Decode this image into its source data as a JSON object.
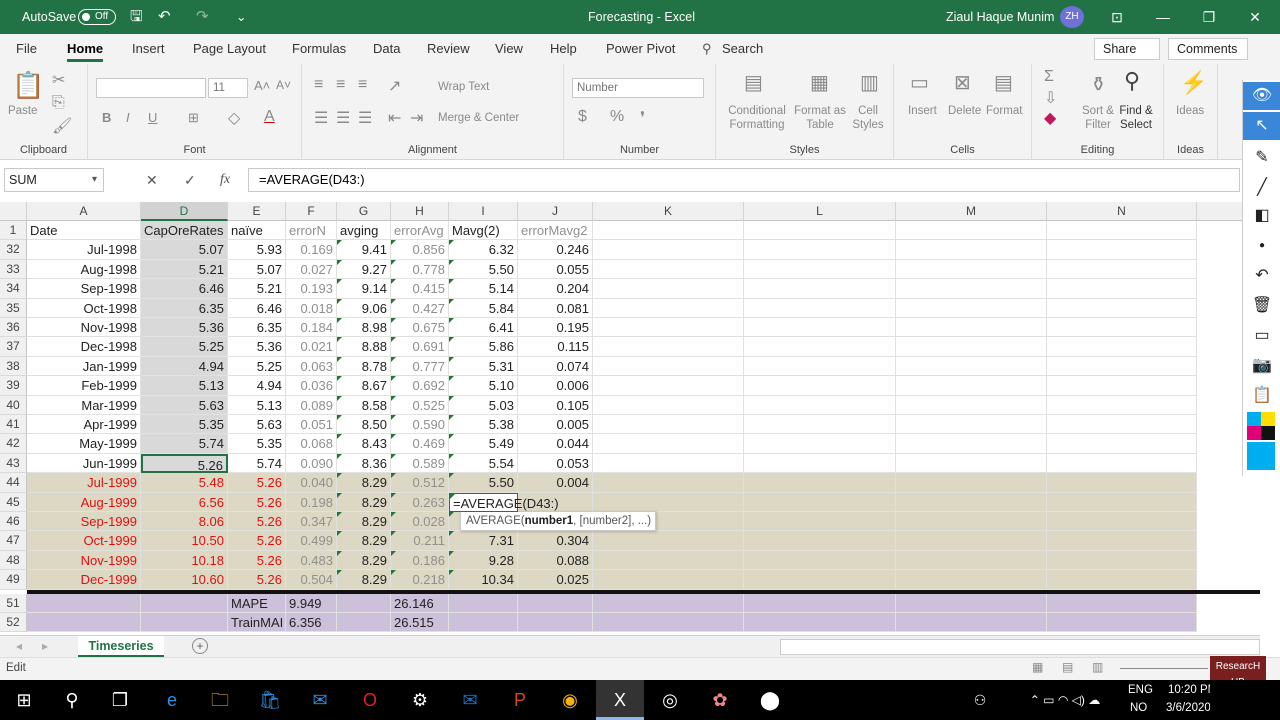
{
  "title": {
    "autosave": "AutoSave",
    "toggle": "Off",
    "doc": "Forecasting - Excel",
    "user": "Ziaul Haque Munim",
    "initials": "ZH"
  },
  "tabs": [
    "File",
    "Home",
    "Insert",
    "Page Layout",
    "Formulas",
    "Data",
    "Review",
    "View",
    "Help",
    "Power Pivot"
  ],
  "search": "Search",
  "share": "Share",
  "comments": "Comments",
  "ribbon": {
    "clipboard": {
      "label": "Clipboard",
      "paste": "Paste"
    },
    "font": {
      "label": "Font",
      "size": "11"
    },
    "alignment": {
      "label": "Alignment",
      "wrap": "Wrap Text",
      "merge": "Merge & Center"
    },
    "number": {
      "label": "Number",
      "format": "Number"
    },
    "styles": {
      "label": "Styles",
      "cond": "Conditional Formatting",
      "table": "Format as Table",
      "cell": "Cell Styles"
    },
    "cells": {
      "label": "Cells",
      "insert": "Insert",
      "delete": "Delete",
      "format": "Format"
    },
    "editing": {
      "label": "Editing",
      "sort": "Sort & Filter",
      "find": "Find & Select"
    },
    "ideas": {
      "label": "Ideas",
      "btn": "Ideas"
    }
  },
  "namebox": "SUM",
  "formula": "=AVERAGE(D43:)",
  "columns": [
    "A",
    "D",
    "E",
    "F",
    "G",
    "H",
    "I",
    "J",
    "K",
    "L",
    "M",
    "N"
  ],
  "header": [
    "Date",
    "CapOreRates",
    "naïve",
    "errorN",
    "avging",
    "errorAvg",
    "Mavg(2)",
    "errorMavg2"
  ],
  "rows": [
    [
      "32",
      "Jul-1998",
      "5.07",
      "5.93",
      "0.169",
      "9.41",
      "0.856",
      "6.32",
      "0.246"
    ],
    [
      "33",
      "Aug-1998",
      "5.21",
      "5.07",
      "0.027",
      "9.27",
      "0.778",
      "5.50",
      "0.055"
    ],
    [
      "34",
      "Sep-1998",
      "6.46",
      "5.21",
      "0.193",
      "9.14",
      "0.415",
      "5.14",
      "0.204"
    ],
    [
      "35",
      "Oct-1998",
      "6.35",
      "6.46",
      "0.018",
      "9.06",
      "0.427",
      "5.84",
      "0.081"
    ],
    [
      "36",
      "Nov-1998",
      "5.36",
      "6.35",
      "0.184",
      "8.98",
      "0.675",
      "6.41",
      "0.195"
    ],
    [
      "37",
      "Dec-1998",
      "5.25",
      "5.36",
      "0.021",
      "8.88",
      "0.691",
      "5.86",
      "0.115"
    ],
    [
      "38",
      "Jan-1999",
      "4.94",
      "5.25",
      "0.063",
      "8.78",
      "0.777",
      "5.31",
      "0.074"
    ],
    [
      "39",
      "Feb-1999",
      "5.13",
      "4.94",
      "0.036",
      "8.67",
      "0.692",
      "5.10",
      "0.006"
    ],
    [
      "40",
      "Mar-1999",
      "5.63",
      "5.13",
      "0.089",
      "8.58",
      "0.525",
      "5.03",
      "0.105"
    ],
    [
      "41",
      "Apr-1999",
      "5.35",
      "5.63",
      "0.051",
      "8.50",
      "0.590",
      "5.38",
      "0.005"
    ],
    [
      "42",
      "May-1999",
      "5.74",
      "5.35",
      "0.068",
      "8.43",
      "0.469",
      "5.49",
      "0.044"
    ],
    [
      "43",
      "Jun-1999",
      "5.26",
      "5.74",
      "0.090",
      "8.36",
      "0.589",
      "5.54",
      "0.053"
    ],
    [
      "44",
      "Jul-1999",
      "5.48",
      "5.26",
      "0.040",
      "8.29",
      "0.512",
      "5.50",
      "0.004"
    ],
    [
      "45",
      "Aug-1999",
      "6.56",
      "5.26",
      "0.198",
      "8.29",
      "0.263",
      "",
      ""
    ],
    [
      "46",
      "Sep-1999",
      "8.06",
      "5.26",
      "0.347",
      "8.29",
      "0.028",
      "",
      ""
    ],
    [
      "47",
      "Oct-1999",
      "10.50",
      "5.26",
      "0.499",
      "8.29",
      "0.211",
      "7.31",
      "0.304"
    ],
    [
      "48",
      "Nov-1999",
      "10.18",
      "5.26",
      "0.483",
      "8.29",
      "0.186",
      "9.28",
      "0.088"
    ],
    [
      "49",
      "Dec-1999",
      "10.60",
      "5.26",
      "0.504",
      "8.29",
      "0.218",
      "10.34",
      "0.025"
    ]
  ],
  "summary": [
    [
      "51",
      "MAPE",
      "9.949",
      "26.146"
    ],
    [
      "52",
      "TrainMAI",
      "6.356",
      "26.515"
    ]
  ],
  "tooltip": {
    "fn": "AVERAGE(",
    "arg": "number1",
    "rest": ", [number2], ...)"
  },
  "sheet": "Timeseries",
  "status": "Edit",
  "tray": {
    "lang1": "ENG",
    "lang2": "NO",
    "time": "10:20 PM",
    "date": "3/6/2020"
  },
  "badge": "ResearcH UB"
}
